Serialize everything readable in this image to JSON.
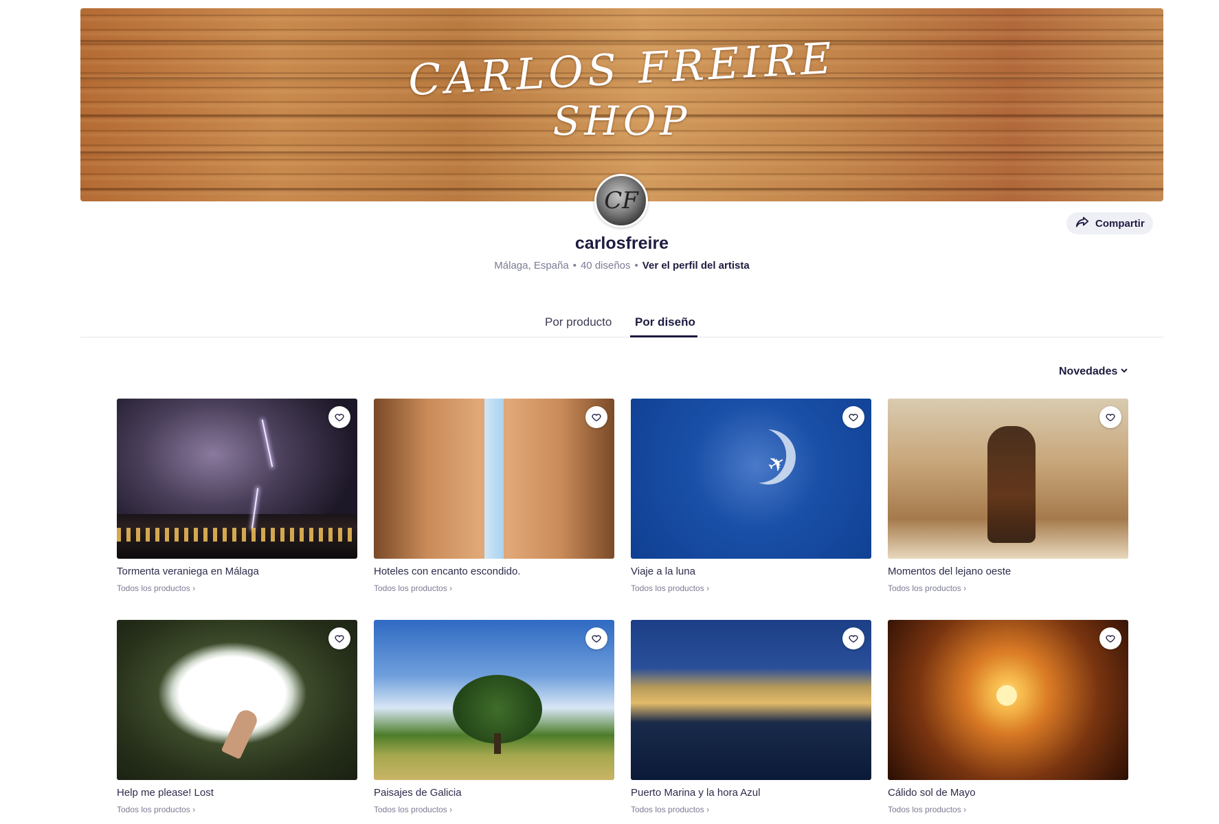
{
  "banner": {
    "line1": "CARLOS FREIRE",
    "line2": "SHOP"
  },
  "avatar": {
    "initials": "CF"
  },
  "share": {
    "label": "Compartir"
  },
  "profile": {
    "username": "carlosfreire",
    "location": "Málaga, España",
    "designs": "40 diseños",
    "artist_link": "Ver el perfil del artista"
  },
  "tabs": [
    {
      "label": "Por producto",
      "active": false
    },
    {
      "label": "Por diseño",
      "active": true
    }
  ],
  "sort": {
    "label": "Novedades"
  },
  "designs": [
    {
      "title": "Tormenta veraniega en Málaga",
      "link": "Todos los productos ›"
    },
    {
      "title": "Hoteles con encanto escondido.",
      "link": "Todos los productos ›"
    },
    {
      "title": "Viaje a la luna",
      "link": "Todos los productos ›"
    },
    {
      "title": "Momentos del lejano oeste",
      "link": "Todos los productos ›"
    },
    {
      "title": "Help me please! Lost",
      "link": "Todos los productos ›"
    },
    {
      "title": "Paisajes de Galicia",
      "link": "Todos los productos ›"
    },
    {
      "title": "Puerto Marina y la hora Azul",
      "link": "Todos los productos ›"
    },
    {
      "title": "Cálido sol de Mayo",
      "link": "Todos los productos ›"
    }
  ]
}
